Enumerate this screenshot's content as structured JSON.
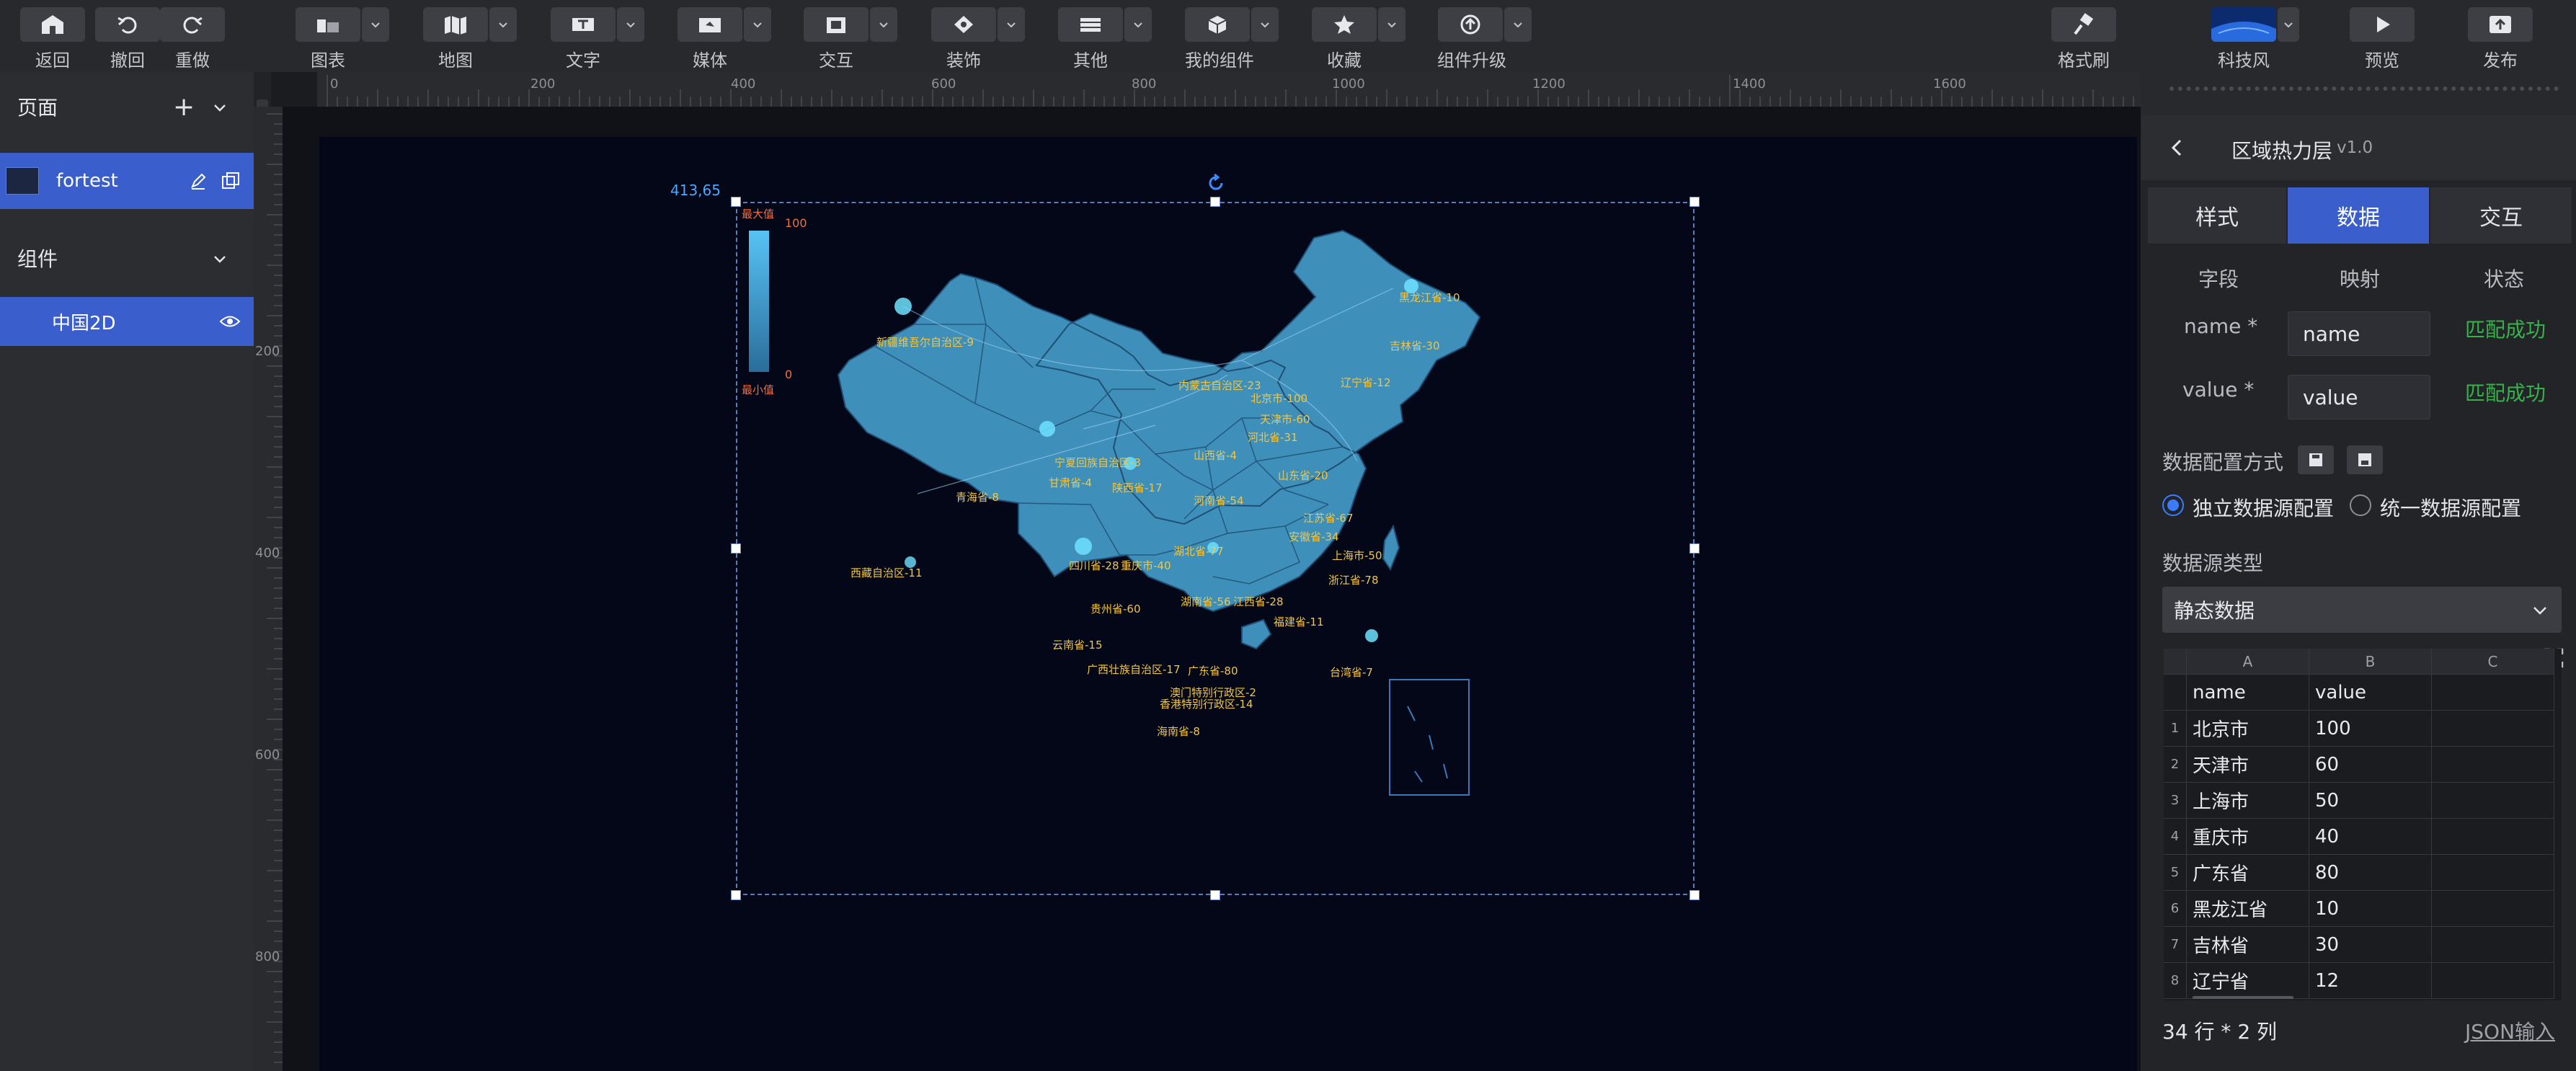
{
  "toolbar": {
    "left": [
      {
        "label": "返回",
        "icon": "home-icon"
      },
      {
        "label": "撤回",
        "icon": "undo-icon"
      },
      {
        "label": "重做",
        "icon": "redo-icon"
      }
    ],
    "groups": [
      {
        "label": "图表",
        "icon": "chart-icon"
      },
      {
        "label": "地图",
        "icon": "map-icon"
      },
      {
        "label": "文字",
        "icon": "text-icon"
      },
      {
        "label": "媒体",
        "icon": "media-icon"
      },
      {
        "label": "交互",
        "icon": "interaction-icon"
      },
      {
        "label": "装饰",
        "icon": "decoration-icon"
      },
      {
        "label": "其他",
        "icon": "other-icon"
      },
      {
        "label": "我的组件",
        "icon": "my-components-icon"
      },
      {
        "label": "收藏",
        "icon": "favorites-icon"
      },
      {
        "label": "组件升级",
        "icon": "upgrade-icon"
      }
    ],
    "right": [
      {
        "label": "格式刷",
        "icon": "format-brush-icon"
      },
      {
        "label": "科技风",
        "icon": "theme-thumbnail-icon"
      },
      {
        "label": "预览",
        "icon": "preview-icon"
      },
      {
        "label": "发布",
        "icon": "publish-icon"
      }
    ]
  },
  "left_panel": {
    "pages_title": "页面",
    "page_name": "fortest",
    "components_title": "组件",
    "component_name": "中国2D"
  },
  "ruler": {
    "h_ticks": [
      "0",
      "200",
      "400",
      "600",
      "800",
      "1000",
      "1200",
      "1400",
      "1600"
    ],
    "v_ticks": [
      "200",
      "400",
      "600",
      "800"
    ]
  },
  "canvas": {
    "coords": "413,65",
    "legend": {
      "max_label": "最大值",
      "min_label": "最小值",
      "max_value": "100",
      "min_value": "0"
    },
    "map_labels": [
      "新疆维吾尔自治区-9",
      "西藏自治区-11",
      "青海省-8",
      "甘肃省-4",
      "宁夏回族自治区-3",
      "陕西省-17",
      "内蒙古自治区-23",
      "山西省-4",
      "北京市-100",
      "天津市-60",
      "河北省-31",
      "辽宁省-12",
      "吉林省-30",
      "黑龙江省-10",
      "山东省-20",
      "河南省-54",
      "江苏省-67",
      "安徽省-34",
      "上海市-50",
      "湖北省-77",
      "四川省-28",
      "重庆市-40",
      "浙江省-78",
      "湖南省-56",
      "江西省-28",
      "贵州省-60",
      "福建省-11",
      "云南省-15",
      "广西壮族自治区-17",
      "广东省-80",
      "台湾省-7",
      "澳门特别行政区-2",
      "香港特别行政区-14",
      "海南省-8"
    ]
  },
  "right_panel": {
    "title": "区域热力层",
    "version": "v1.0",
    "tabs": [
      "样式",
      "数据",
      "交互"
    ],
    "active_tab": "数据",
    "columns": [
      "字段",
      "映射",
      "状态"
    ],
    "fields": [
      {
        "label": "name *",
        "value": "name",
        "status": "匹配成功"
      },
      {
        "label": "value *",
        "value": "value",
        "status": "匹配成功"
      }
    ],
    "config_label": "数据配置方式",
    "radio_independent": "独立数据源配置",
    "radio_unified": "统一数据源配置",
    "source_type_label": "数据源类型",
    "source_type_value": "静态数据",
    "grid": {
      "col_letters": [
        "A",
        "B",
        "C"
      ],
      "header": [
        "name",
        "value"
      ],
      "rows": [
        {
          "n": "1",
          "name": "北京市",
          "value": "100"
        },
        {
          "n": "2",
          "name": "天津市",
          "value": "60"
        },
        {
          "n": "3",
          "name": "上海市",
          "value": "50"
        },
        {
          "n": "4",
          "name": "重庆市",
          "value": "40"
        },
        {
          "n": "5",
          "name": "广东省",
          "value": "80"
        },
        {
          "n": "6",
          "name": "黑龙江省",
          "value": "10"
        },
        {
          "n": "7",
          "name": "吉林省",
          "value": "30"
        },
        {
          "n": "8",
          "name": "辽宁省",
          "value": "12"
        }
      ]
    },
    "footer_count": "34 行 * 2 列",
    "json_input": "JSON输入"
  },
  "colors": {
    "accent": "#3a5fcd",
    "success": "#35b34a",
    "map_fill": "#3f8fbb",
    "map_label": "#f1c643",
    "stage": "#030717"
  }
}
